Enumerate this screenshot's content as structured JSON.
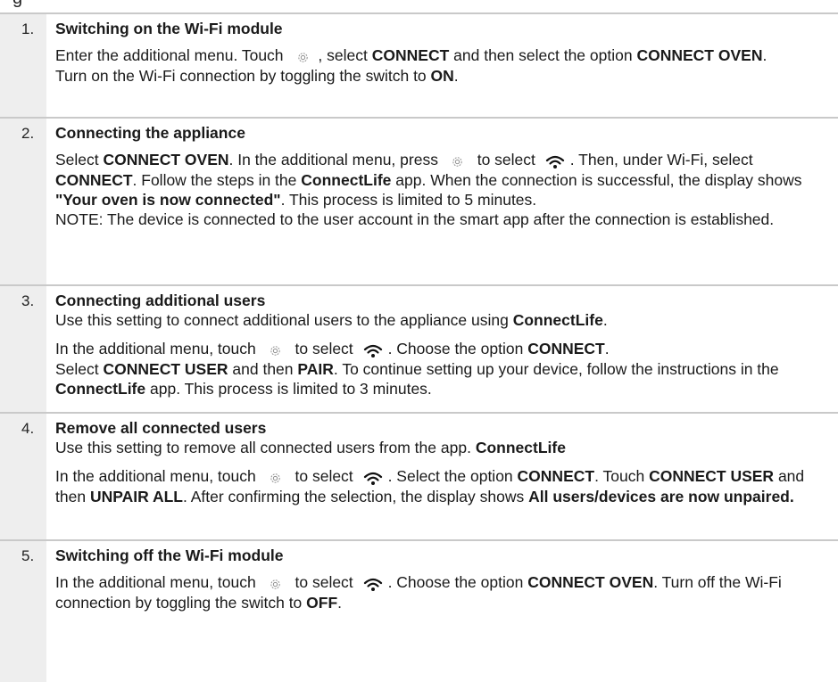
{
  "top_cut_text": "g",
  "steps": [
    {
      "number": "1.",
      "title": "Switching on the Wi-Fi module",
      "l1_a": "Enter the additional menu. Touch",
      "l1_b": ", select",
      "l1_c": "CONNECT",
      "l1_d": "and then select the option",
      "l1_e": "CONNECT OVEN",
      "l1_f": ".",
      "l2_a": "Turn on the Wi-Fi connection by toggling the switch to",
      "l2_b": "ON",
      "l2_c": "."
    },
    {
      "number": "2.",
      "title": "Connecting the appliance",
      "a": "Select",
      "b": "CONNECT OVEN",
      "c": ". In the additional menu, press",
      "d": "to select",
      "e": ". Then, under Wi-Fi, select",
      "f": "CONNECT",
      "g": ". Follow the steps in the",
      "h": "ConnectLife",
      "i": "app. When the connection is successful, the display shows",
      "j": "\"Your oven is now connected\"",
      "k": ". This process is limited to 5 minutes.",
      "note": "NOTE: The device is connected to the user account in the smart app after the connection is established."
    },
    {
      "number": "3.",
      "title": "Connecting additional users",
      "intro_a": "Use this setting to connect additional users to the appliance using",
      "intro_b": "ConnectLife",
      "intro_c": ".",
      "a": "In the additional menu, touch",
      "b": "to select",
      "c": ". Choose the option",
      "d": "CONNECT",
      "e": ".",
      "f": "Select",
      "g": "CONNECT USER",
      "h": "and then",
      "i": "PAIR",
      "j": ". To continue setting up your device, follow the instructions in the",
      "k": "ConnectLife",
      "l": "app. This process is limited to 3 minutes."
    },
    {
      "number": "4.",
      "title": "Remove all connected users",
      "intro_a": "Use this setting to remove all connected users from the app.",
      "intro_b": "ConnectLife",
      "a": "In the additional menu, touch",
      "b": "to select",
      "c": ". Select the option",
      "d": "CONNECT",
      "e": ". Touch",
      "f": "CONNECT USER",
      "g": "and then",
      "h": "UNPAIR ALL",
      "i": ". After confirming the selection, the display shows",
      "j": "All users/devices are now unpaired."
    },
    {
      "number": "5.",
      "title": "Switching off the Wi-Fi module",
      "a": "In the additional menu, touch",
      "b": "to select",
      "c": ". Choose the option",
      "d": "CONNECT OVEN",
      "e": ". Turn off the Wi-Fi connection by toggling the switch to",
      "f": "OFF",
      "g": "."
    }
  ],
  "icons": {
    "settings": "gear-icon",
    "wifi": "wifi-icon"
  },
  "colors": {
    "number_column": "#eeeeee",
    "divider": "#c9c9c9",
    "text": "#1a1a1a"
  }
}
